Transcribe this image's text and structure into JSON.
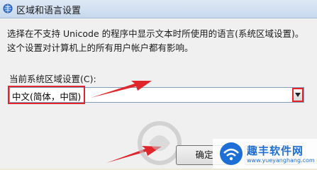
{
  "window": {
    "title": "区域和语言设置"
  },
  "main": {
    "description": "选择在不支持 Unicode 的程序中显示文本时所使用的语言(系统区域设置)。这个设置对计算机上的所有用户帐户都有影响。",
    "locale_label": "当前系统区域设置(C):",
    "locale_value": "中文(简体，中国)"
  },
  "buttons": {
    "ok_label": "确定"
  },
  "watermark": {
    "site_name": "趣丰软件网",
    "site_url": "www.yueyanghang.com"
  },
  "colors": {
    "annotation_red": "#e0262a",
    "brand_blue": "#1d6fd6"
  }
}
